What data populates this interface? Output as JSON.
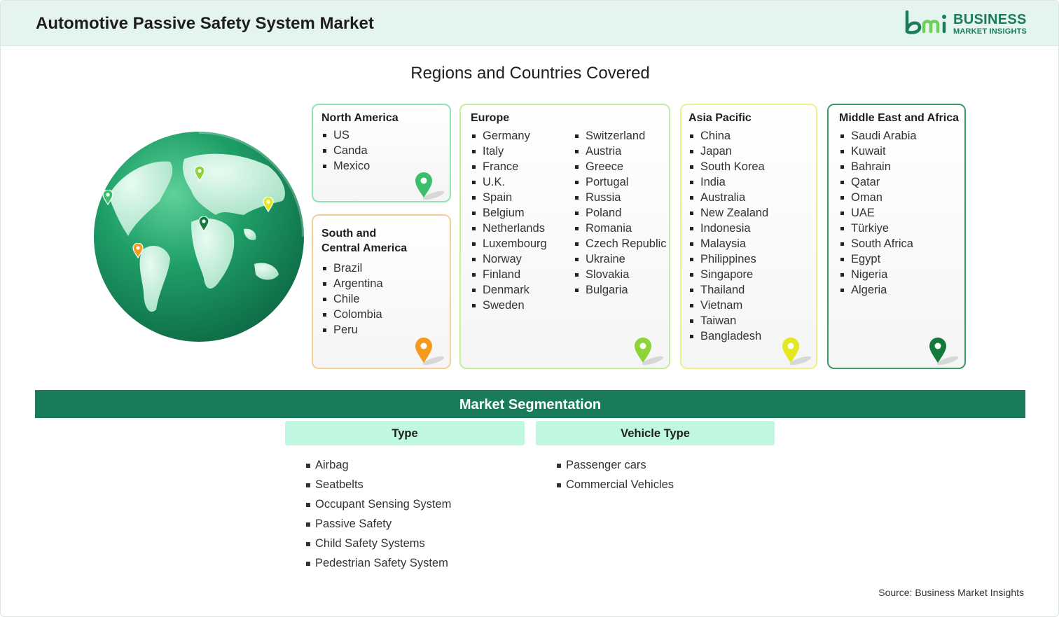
{
  "header": {
    "title": "Automotive Passive Safety System Market",
    "logo": {
      "mark": "bmi",
      "word1": "BUSINESS",
      "word2": "MARKET INSIGHTS",
      "color": "#1a7b5d"
    }
  },
  "regions": {
    "title": "Regions and Countries Covered",
    "north_america": {
      "title": "North America",
      "items": [
        "US",
        "Canda",
        "Mexico"
      ],
      "pin_color": "#3cbf6a"
    },
    "south_america": {
      "title_line1": "South and",
      "title_line2": "Central America",
      "items": [
        "Brazil",
        "Argentina",
        "Chile",
        "Colombia",
        "Peru"
      ],
      "pin_color": "#f39a1f"
    },
    "europe": {
      "title": "Europe",
      "col1": [
        "Germany",
        "Italy",
        "France",
        "U.K.",
        "Spain",
        "Belgium",
        "Netherlands",
        "Luxembourg",
        "Norway",
        "Finland",
        "Denmark",
        "Sweden"
      ],
      "col2": [
        "Switzerland",
        "Austria",
        "Greece",
        "Portugal",
        "Russia",
        "Poland",
        "Romania",
        "Czech Republic",
        "Ukraine",
        "Slovakia",
        "Bulgaria"
      ],
      "pin_color": "#8cd43a"
    },
    "asia_pacific": {
      "title": "Asia Pacific",
      "items": [
        "China",
        "Japan",
        "South Korea",
        "India",
        "Australia",
        "New Zealand",
        "Indonesia",
        "Malaysia",
        "Philippines",
        "Singapore",
        "Thailand",
        "Vietnam",
        "Taiwan",
        "Bangladesh"
      ],
      "pin_color": "#e3e81f"
    },
    "mea": {
      "title": "Middle East and Africa",
      "items": [
        "Saudi Arabia",
        "Kuwait",
        "Bahrain",
        "Qatar",
        "Oman",
        "UAE",
        "Türkiye",
        "South Africa",
        "Egypt",
        "Nigeria",
        "Algeria"
      ],
      "pin_color": "#137a3c"
    }
  },
  "segmentation": {
    "title": "Market Segmentation",
    "type": {
      "title": "Type",
      "items": [
        "Airbag",
        "Seatbelts",
        "Occupant Sensing System",
        "Passive Safety",
        "Child Safety Systems",
        "Pedestrian Safety System"
      ]
    },
    "vehicle_type": {
      "title": "Vehicle Type",
      "items": [
        "Passenger cars",
        "Commercial Vehicles"
      ]
    }
  },
  "source": "Source: Business Market Insights",
  "colors": {
    "accent": "#197a5c",
    "header_bg": "#e4f4ee",
    "segment_head_bg": "#bff7e0"
  }
}
